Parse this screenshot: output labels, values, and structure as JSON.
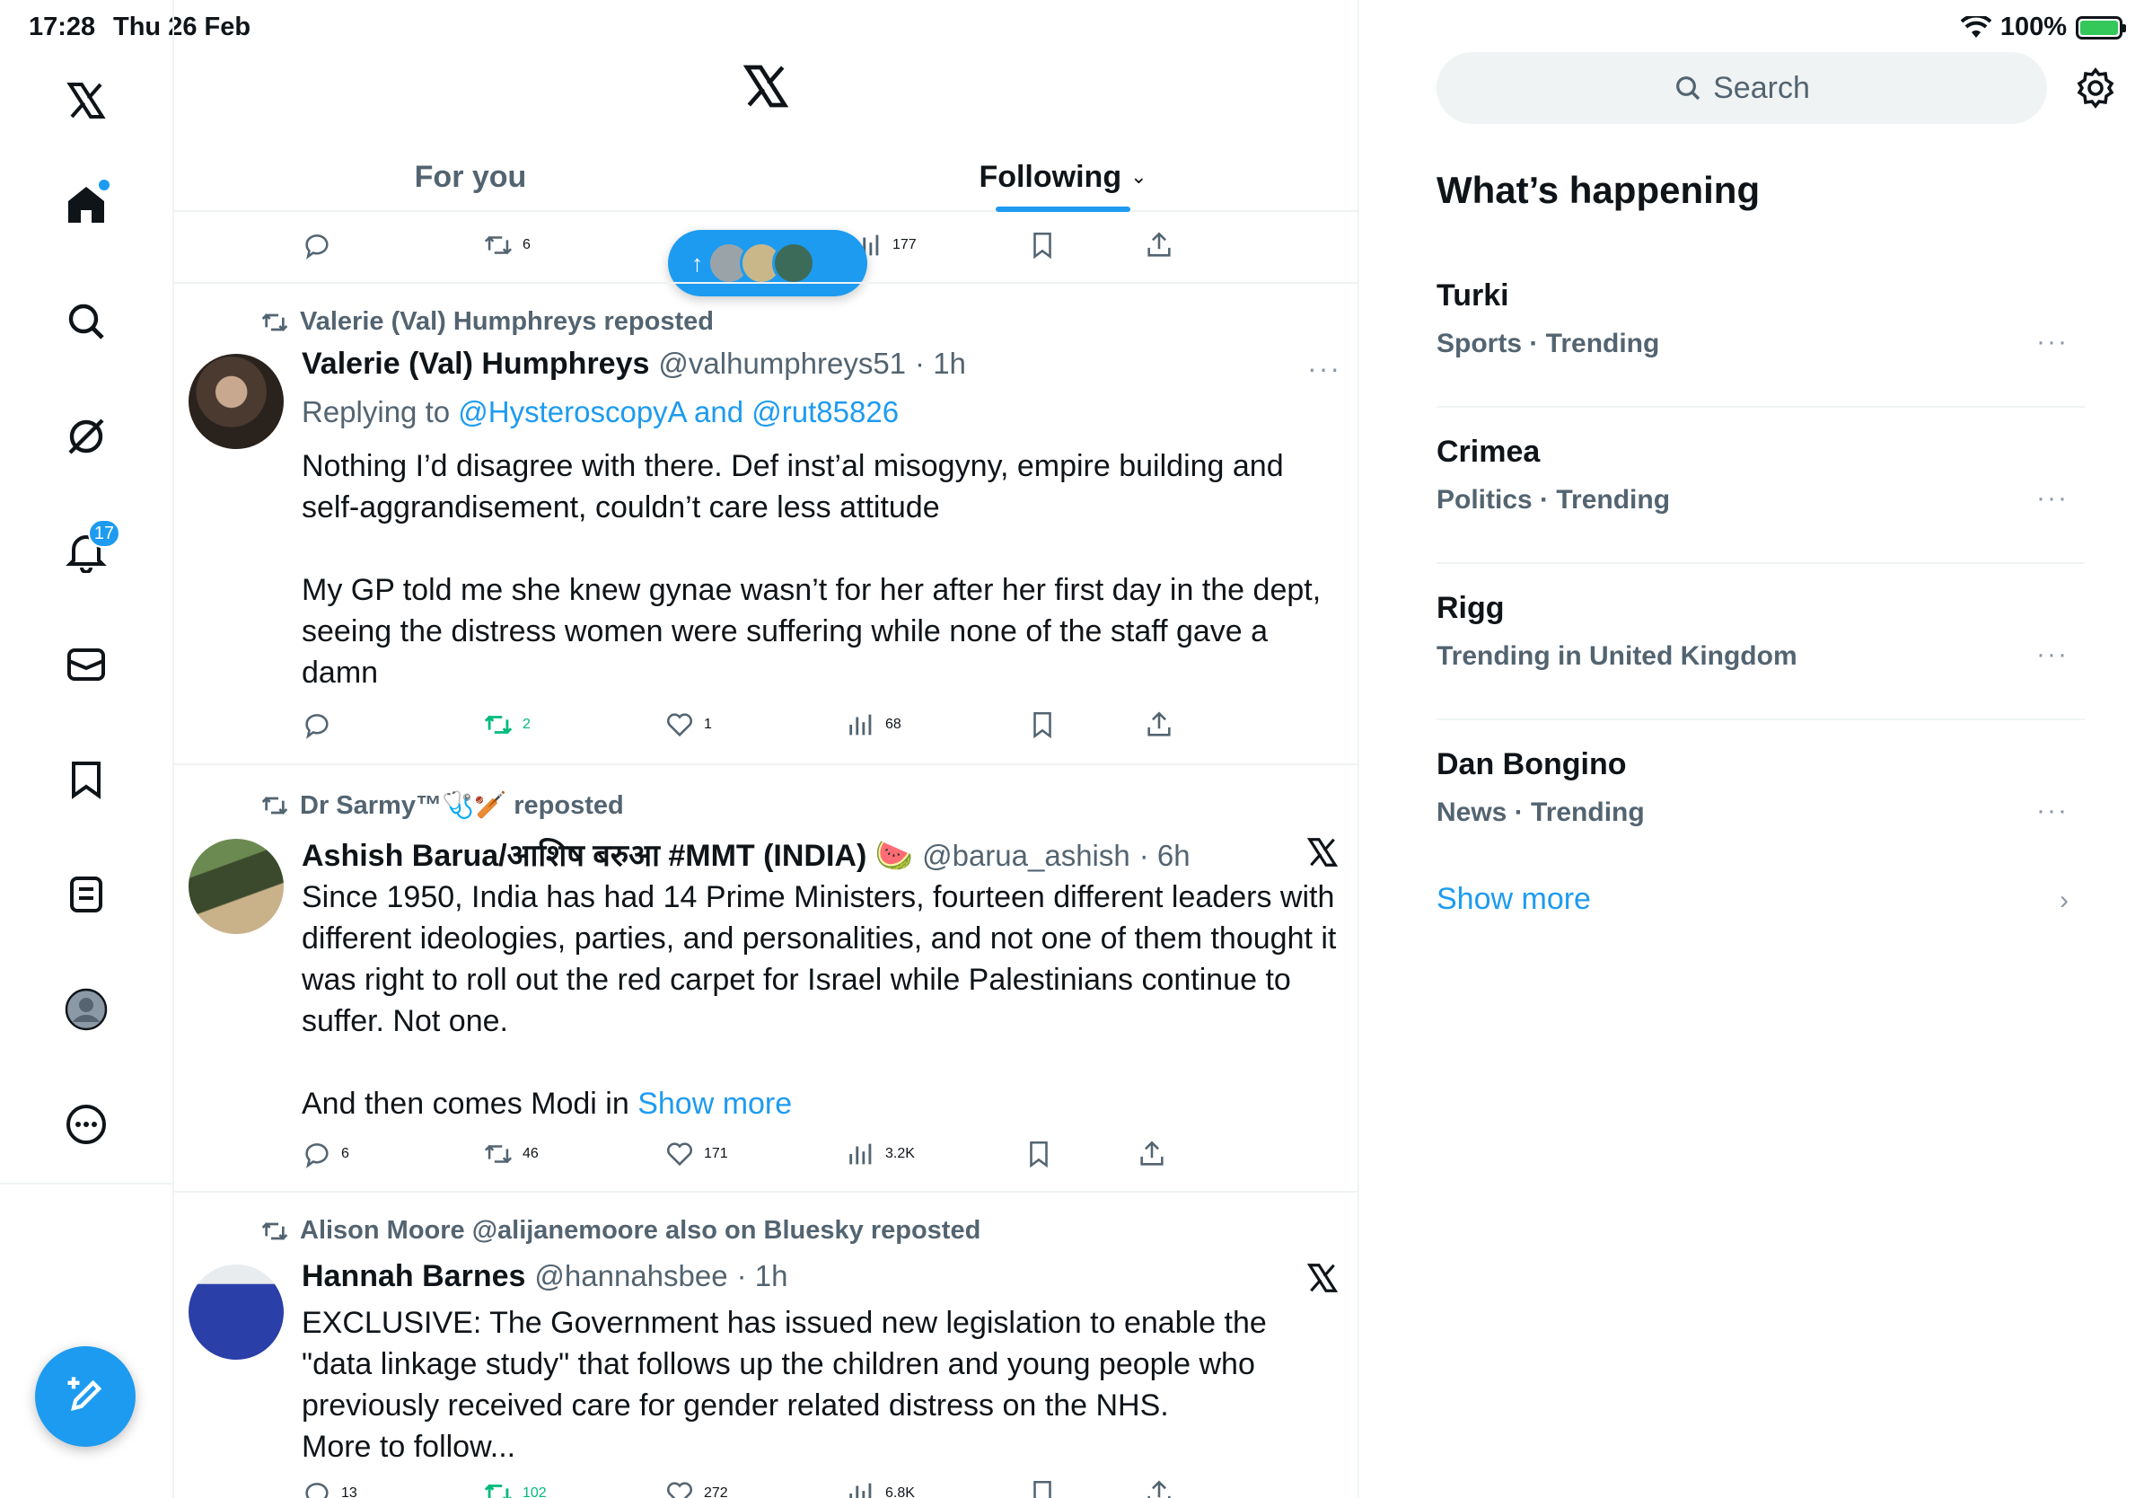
{
  "status_bar": {
    "time": "17:28",
    "date": "Thu 26 Feb",
    "battery": "100%"
  },
  "nav": {
    "notifications_badge": "17",
    "items": [
      "x-logo",
      "home",
      "search",
      "grok",
      "notifications",
      "messages",
      "bookmarks",
      "lists",
      "profile",
      "more"
    ]
  },
  "header": {
    "tabs": [
      {
        "label": "For you"
      },
      {
        "label": "Following",
        "active": true
      }
    ]
  },
  "top_actions": {
    "reposts": "6",
    "views": "177"
  },
  "posts": [
    {
      "repost_by": "Valerie (Val) Humphreys reposted",
      "name": "Valerie (Val) Humphreys",
      "handle": "@valhumphreys51",
      "time": "· 1h",
      "replying_label": "Replying to",
      "replying_to": "@HysteroscopyA and @rut85826",
      "text": "Nothing I’d disagree with there. Def inst’al misogyny, empire building and self-aggrandisement, couldn’t care less attitude\n\nMy GP told me she knew gynae wasn’t for her after her first day in the dept, seeing the distress women were suffering while none of the staff gave a damn",
      "replies": "",
      "reposts": "2",
      "likes": "1",
      "views": "68"
    },
    {
      "repost_by": "Dr Sarmy™🩺🏏 reposted",
      "name": "Ashish Barua/आशिष बरुआ #MMT (INDIA) 🍉",
      "handle": "@barua_ashish",
      "time": "· 6h",
      "text": "Since 1950, India has had 14 Prime Ministers, fourteen different leaders with different ideologies, parties, and personalities, and not one of them thought it was right to roll out the red carpet for Israel while Palestinians continue to suffer. Not one.\n\nAnd then comes Modi in ",
      "show_more": "Show more",
      "replies": "6",
      "reposts": "46",
      "likes": "171",
      "views": "3.2K"
    },
    {
      "repost_by": "Alison Moore @alijanemoore also on Bluesky reposted",
      "name": "Hannah Barnes",
      "handle": "@hannahsbee",
      "time": "· 1h",
      "text": "EXCLUSIVE: The Government has issued new legislation to enable the \"data linkage study\" that follows up the children and young people who previously received care for gender related distress on the NHS.\nMore to follow...",
      "replies": "13",
      "reposts": "102",
      "likes": "272",
      "views": "6.8K"
    }
  ],
  "right": {
    "search_placeholder": "Search",
    "title": "What’s happening",
    "trends": [
      {
        "name": "Turki",
        "meta": "Sports · Trending"
      },
      {
        "name": "Crimea",
        "meta": "Politics · Trending"
      },
      {
        "name": "Rigg",
        "meta": "Trending in United Kingdom"
      },
      {
        "name": "Dan Bongino",
        "meta": "News · Trending"
      }
    ],
    "show_more": "Show more"
  },
  "colors": {
    "accent": "#1d9bf0",
    "repost_green": "#00ba7c",
    "muted": "#536471"
  }
}
